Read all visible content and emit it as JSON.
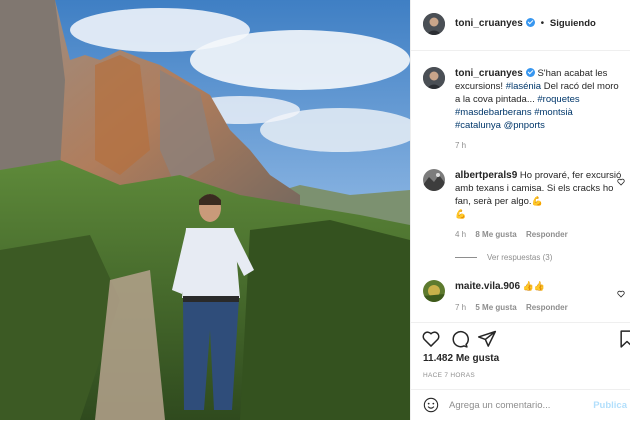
{
  "post": {
    "author": "toni_cruanyes",
    "follow_separator": "•",
    "follow_status": "Siguiendo",
    "photo_icon": "landscape-photo"
  },
  "caption": {
    "username": "toni_cruanyes",
    "text_lines": [
      {
        "parts": [
          {
            "t": "S'han acabat les",
            "tag": false
          }
        ]
      },
      {
        "parts": [
          {
            "t": "excursions! ",
            "tag": false
          },
          {
            "t": "#lasénia",
            "tag": true
          },
          {
            "t": " Del racó del moro",
            "tag": false
          }
        ]
      },
      {
        "parts": [
          {
            "t": "a la cova pintada... ",
            "tag": false
          },
          {
            "t": "#roquetes",
            "tag": true
          }
        ]
      },
      {
        "parts": [
          {
            "t": "#masdebarberans",
            "tag": true
          },
          {
            "t": " ",
            "tag": false
          },
          {
            "t": "#montsià",
            "tag": true
          }
        ]
      },
      {
        "parts": [
          {
            "t": "#catalunya",
            "tag": true
          },
          {
            "t": " ",
            "tag": false
          },
          {
            "t": "@pnports",
            "tag": true
          }
        ]
      }
    ],
    "time": "7 h"
  },
  "comments": [
    {
      "username": "albertperals9",
      "text": "Ho provaré, fer excursió amb texans i camisa. Si els cracks ho fan, serà per algo.",
      "emoji_after_text": "💪",
      "emoji_start_line": "💪",
      "time": "4 h",
      "likes": "8 Me gusta",
      "reply": "Responder",
      "view_replies": "Ver respuestas (3)"
    },
    {
      "username": "maite.vila.906",
      "text": "",
      "emojis": "👍👍",
      "time": "7 h",
      "likes": "5 Me gusta",
      "reply": "Responder"
    }
  ],
  "actions": {
    "like_icon": "heart-icon",
    "comment_icon": "comment-icon",
    "share_icon": "share-icon",
    "save_icon": "bookmark-icon",
    "likes_count": "11.482 Me gusta",
    "posted_ago": "HACE 7 HORAS"
  },
  "comment_box": {
    "placeholder": "Agrega un comentario...",
    "publish_label": "Publica"
  },
  "colors": {
    "link": "#00376b",
    "verified": "#3897f0",
    "muted": "#8e8e8e",
    "publish_disabled": "#b2dffc"
  }
}
